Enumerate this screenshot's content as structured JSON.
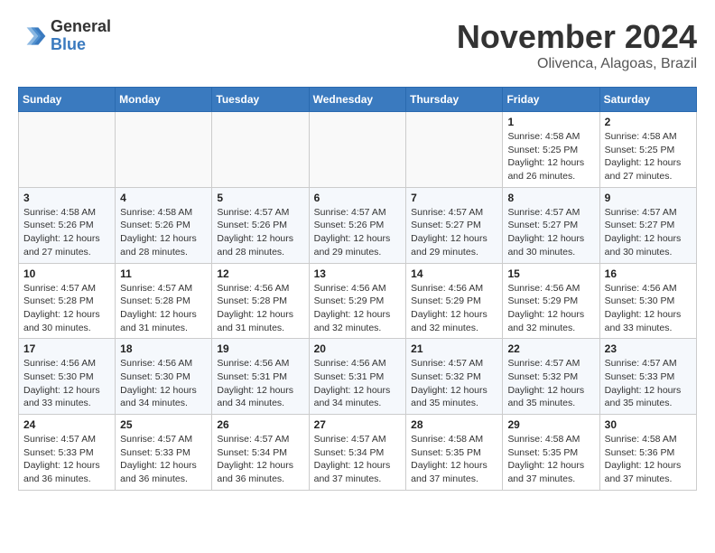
{
  "header": {
    "logo_general": "General",
    "logo_blue": "Blue",
    "month_year": "November 2024",
    "location": "Olivenca, Alagoas, Brazil"
  },
  "days_of_week": [
    "Sunday",
    "Monday",
    "Tuesday",
    "Wednesday",
    "Thursday",
    "Friday",
    "Saturday"
  ],
  "weeks": [
    [
      {
        "day": "",
        "info": ""
      },
      {
        "day": "",
        "info": ""
      },
      {
        "day": "",
        "info": ""
      },
      {
        "day": "",
        "info": ""
      },
      {
        "day": "",
        "info": ""
      },
      {
        "day": "1",
        "info": "Sunrise: 4:58 AM\nSunset: 5:25 PM\nDaylight: 12 hours and 26 minutes."
      },
      {
        "day": "2",
        "info": "Sunrise: 4:58 AM\nSunset: 5:25 PM\nDaylight: 12 hours and 27 minutes."
      }
    ],
    [
      {
        "day": "3",
        "info": "Sunrise: 4:58 AM\nSunset: 5:26 PM\nDaylight: 12 hours and 27 minutes."
      },
      {
        "day": "4",
        "info": "Sunrise: 4:58 AM\nSunset: 5:26 PM\nDaylight: 12 hours and 28 minutes."
      },
      {
        "day": "5",
        "info": "Sunrise: 4:57 AM\nSunset: 5:26 PM\nDaylight: 12 hours and 28 minutes."
      },
      {
        "day": "6",
        "info": "Sunrise: 4:57 AM\nSunset: 5:26 PM\nDaylight: 12 hours and 29 minutes."
      },
      {
        "day": "7",
        "info": "Sunrise: 4:57 AM\nSunset: 5:27 PM\nDaylight: 12 hours and 29 minutes."
      },
      {
        "day": "8",
        "info": "Sunrise: 4:57 AM\nSunset: 5:27 PM\nDaylight: 12 hours and 30 minutes."
      },
      {
        "day": "9",
        "info": "Sunrise: 4:57 AM\nSunset: 5:27 PM\nDaylight: 12 hours and 30 minutes."
      }
    ],
    [
      {
        "day": "10",
        "info": "Sunrise: 4:57 AM\nSunset: 5:28 PM\nDaylight: 12 hours and 30 minutes."
      },
      {
        "day": "11",
        "info": "Sunrise: 4:57 AM\nSunset: 5:28 PM\nDaylight: 12 hours and 31 minutes."
      },
      {
        "day": "12",
        "info": "Sunrise: 4:56 AM\nSunset: 5:28 PM\nDaylight: 12 hours and 31 minutes."
      },
      {
        "day": "13",
        "info": "Sunrise: 4:56 AM\nSunset: 5:29 PM\nDaylight: 12 hours and 32 minutes."
      },
      {
        "day": "14",
        "info": "Sunrise: 4:56 AM\nSunset: 5:29 PM\nDaylight: 12 hours and 32 minutes."
      },
      {
        "day": "15",
        "info": "Sunrise: 4:56 AM\nSunset: 5:29 PM\nDaylight: 12 hours and 32 minutes."
      },
      {
        "day": "16",
        "info": "Sunrise: 4:56 AM\nSunset: 5:30 PM\nDaylight: 12 hours and 33 minutes."
      }
    ],
    [
      {
        "day": "17",
        "info": "Sunrise: 4:56 AM\nSunset: 5:30 PM\nDaylight: 12 hours and 33 minutes."
      },
      {
        "day": "18",
        "info": "Sunrise: 4:56 AM\nSunset: 5:30 PM\nDaylight: 12 hours and 34 minutes."
      },
      {
        "day": "19",
        "info": "Sunrise: 4:56 AM\nSunset: 5:31 PM\nDaylight: 12 hours and 34 minutes."
      },
      {
        "day": "20",
        "info": "Sunrise: 4:56 AM\nSunset: 5:31 PM\nDaylight: 12 hours and 34 minutes."
      },
      {
        "day": "21",
        "info": "Sunrise: 4:57 AM\nSunset: 5:32 PM\nDaylight: 12 hours and 35 minutes."
      },
      {
        "day": "22",
        "info": "Sunrise: 4:57 AM\nSunset: 5:32 PM\nDaylight: 12 hours and 35 minutes."
      },
      {
        "day": "23",
        "info": "Sunrise: 4:57 AM\nSunset: 5:33 PM\nDaylight: 12 hours and 35 minutes."
      }
    ],
    [
      {
        "day": "24",
        "info": "Sunrise: 4:57 AM\nSunset: 5:33 PM\nDaylight: 12 hours and 36 minutes."
      },
      {
        "day": "25",
        "info": "Sunrise: 4:57 AM\nSunset: 5:33 PM\nDaylight: 12 hours and 36 minutes."
      },
      {
        "day": "26",
        "info": "Sunrise: 4:57 AM\nSunset: 5:34 PM\nDaylight: 12 hours and 36 minutes."
      },
      {
        "day": "27",
        "info": "Sunrise: 4:57 AM\nSunset: 5:34 PM\nDaylight: 12 hours and 37 minutes."
      },
      {
        "day": "28",
        "info": "Sunrise: 4:58 AM\nSunset: 5:35 PM\nDaylight: 12 hours and 37 minutes."
      },
      {
        "day": "29",
        "info": "Sunrise: 4:58 AM\nSunset: 5:35 PM\nDaylight: 12 hours and 37 minutes."
      },
      {
        "day": "30",
        "info": "Sunrise: 4:58 AM\nSunset: 5:36 PM\nDaylight: 12 hours and 37 minutes."
      }
    ]
  ]
}
